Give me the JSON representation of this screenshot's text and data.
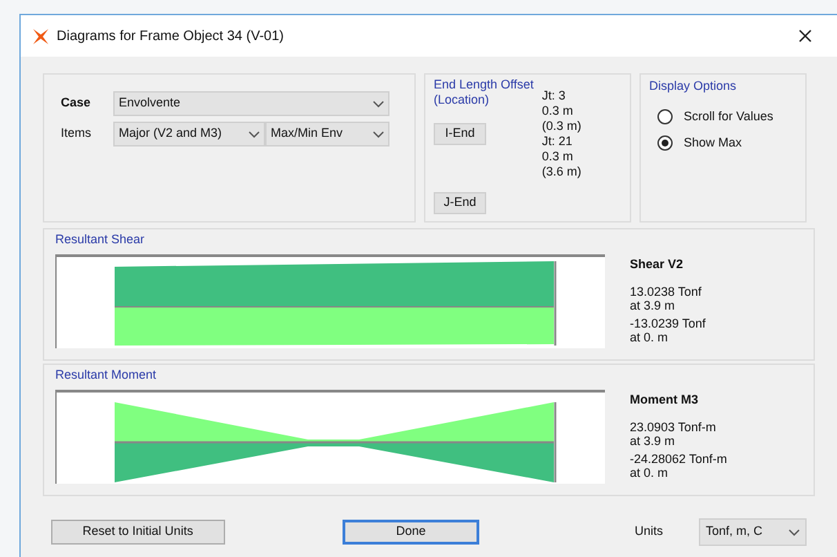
{
  "window": {
    "title": "Diagrams for Frame Object 34  (V-01)"
  },
  "case": {
    "label": "Case",
    "value": "Envolvente"
  },
  "items": {
    "label": "Items",
    "component": "Major (V2 and M3)",
    "type": "Max/Min Env"
  },
  "end_length_offset": {
    "title": "End Length Offset\n(Location)",
    "ends": [
      {
        "button": "I-End",
        "joint": "Jt:  3",
        "offset": "0.3 m",
        "location": "(0.3 m)"
      },
      {
        "button": "J-End",
        "joint": "Jt:  21",
        "offset": "0.3 m",
        "location": "(3.6 m)"
      }
    ]
  },
  "display_options": {
    "title": "Display Options",
    "options": [
      {
        "label": "Scroll for Values",
        "selected": false
      },
      {
        "label": "Show Max",
        "selected": true
      }
    ]
  },
  "panels": [
    {
      "kind": "shear",
      "title": "Resultant Shear",
      "heading": "Shear V2",
      "max": "13.0238 Tonf",
      "max_at": "at 3.9 m",
      "min": "-13.0239 Tonf",
      "min_at": "at 0. m"
    },
    {
      "kind": "moment",
      "title": "Resultant Moment",
      "heading": "Moment M3",
      "max": "23.0903 Tonf-m",
      "max_at": "at 3.9 m",
      "min": "-24.28062 Tonf-m",
      "min_at": "at 0. m"
    }
  ],
  "buttons": {
    "reset": "Reset to Initial Units",
    "done": "Done"
  },
  "units": {
    "label": "Units",
    "value": "Tonf, m, C"
  }
}
